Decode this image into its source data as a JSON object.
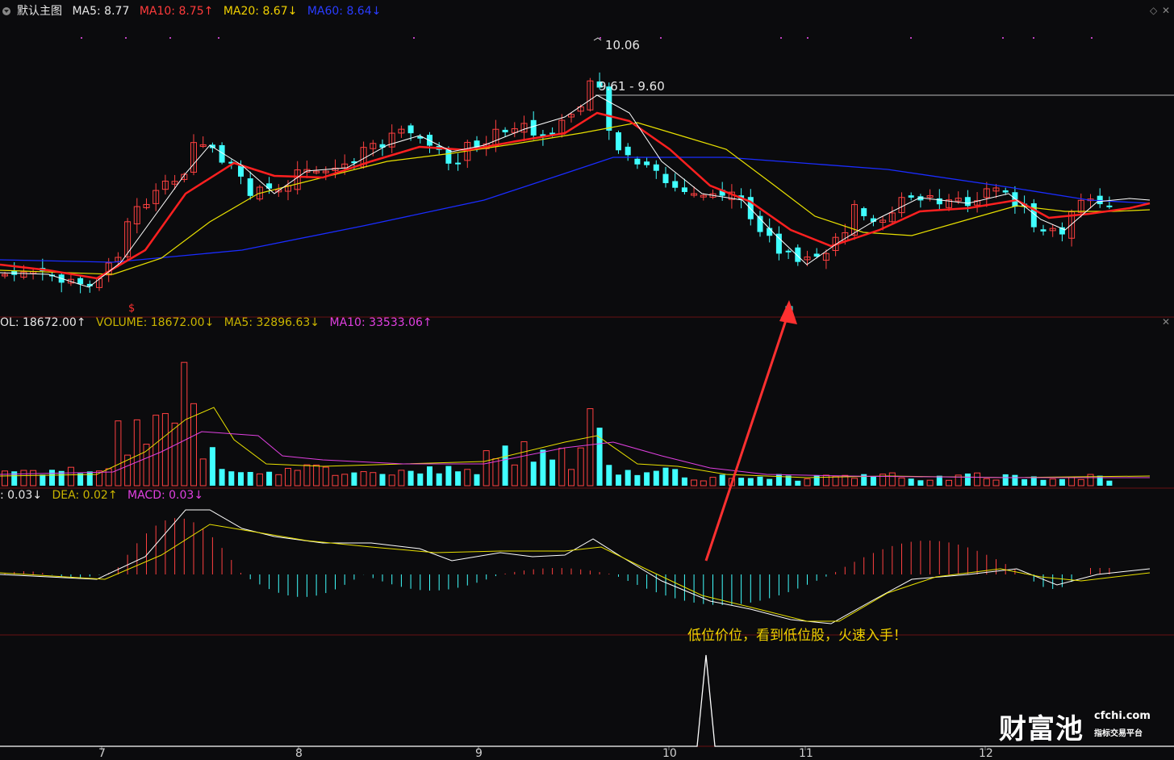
{
  "main_header": {
    "title": "默认主图",
    "ma5": "MA5: 8.77",
    "ma10": "MA10: 8.75↑",
    "ma20": "MA20: 8.67↓",
    "ma60": "MA60: 8.64↓"
  },
  "vol_header": {
    "vol": "OL: 18672.00↑",
    "volume": "VOLUME: 18672.00↓",
    "ma5": "MA5: 32896.63↓",
    "ma10": "MA10: 33533.06↑"
  },
  "macd_header": {
    "dif": ": 0.03↓",
    "dea": "DEA: 0.02↑",
    "macd": "MACD: 0.03↓"
  },
  "price_labels": {
    "high": "10.06",
    "range": "9.61 - 9.60",
    "marker": "$"
  },
  "x_axis": [
    "7",
    "8",
    "9",
    "10",
    "11",
    "12"
  ],
  "annotation": "低位价位，看到低位股，火速入手！",
  "watermark": {
    "name": "财富池",
    "domain": "cfchi.com",
    "tagline": "指标交易平台"
  },
  "colors": {
    "up": "#ff4040",
    "down": "#40ffff",
    "ma5": "#ffffff",
    "ma10": "#ff2020",
    "ma20": "#e8e000",
    "ma60": "#1a2cff",
    "vol_ma5": "#e8e000",
    "vol_ma10": "#e040e0",
    "grid": "#5a1010"
  }
}
